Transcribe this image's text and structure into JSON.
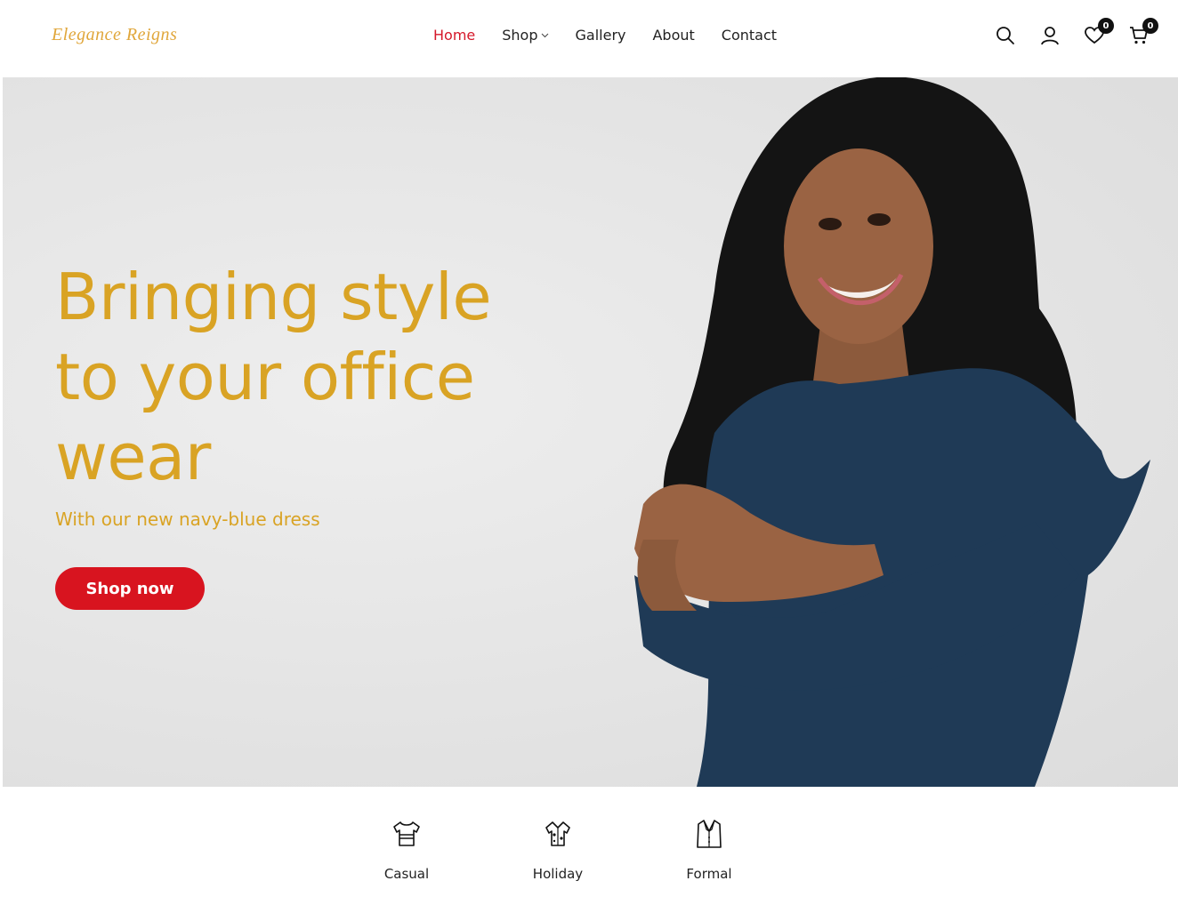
{
  "brand": {
    "logo_text": "Elegance Reigns",
    "accent": "#d5182a",
    "gold": "#d9a324"
  },
  "nav": {
    "items": [
      {
        "label": "Home",
        "active": true
      },
      {
        "label": "Shop",
        "has_dropdown": true
      },
      {
        "label": "Gallery"
      },
      {
        "label": "About"
      },
      {
        "label": "Contact"
      }
    ]
  },
  "header_icons": {
    "search": "search-icon",
    "account": "user-icon",
    "wishlist": {
      "icon": "heart-icon",
      "count": "0"
    },
    "cart": {
      "icon": "cart-icon",
      "count": "0"
    }
  },
  "hero": {
    "title": "Bringing style to your office wear",
    "subtitle": "With our new navy-blue dress",
    "cta_label": "Shop now"
  },
  "categories": [
    {
      "label": "Casual",
      "icon": "tshirt-icon"
    },
    {
      "label": "Holiday",
      "icon": "hawaiian-shirt-icon"
    },
    {
      "label": "Formal",
      "icon": "blazer-icon"
    }
  ]
}
